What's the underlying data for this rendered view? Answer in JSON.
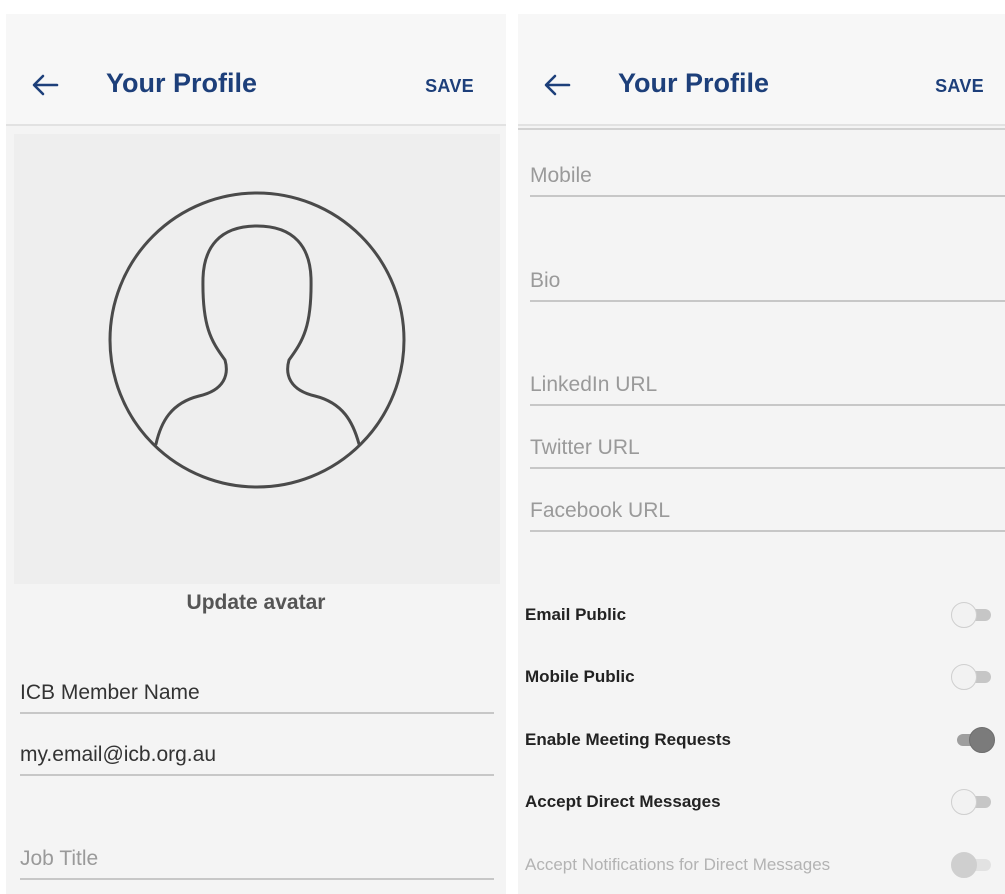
{
  "left_screen": {
    "header": {
      "title": "Your Profile",
      "save_label": "SAVE"
    },
    "avatar": {
      "action_label": "Update avatar"
    },
    "fields": [
      {
        "value": "ICB Member Name",
        "placeholder": ""
      },
      {
        "value": "my.email@icb.org.au",
        "placeholder": ""
      },
      {
        "value": "",
        "placeholder": "Job Title"
      }
    ]
  },
  "right_screen": {
    "header": {
      "title": "Your Profile",
      "save_label": "SAVE"
    },
    "fields": [
      {
        "value": "",
        "placeholder": "Mobile"
      },
      {
        "value": "",
        "placeholder": "Bio"
      },
      {
        "value": "",
        "placeholder": "LinkedIn URL"
      },
      {
        "value": "",
        "placeholder": "Twitter URL"
      },
      {
        "value": "",
        "placeholder": "Facebook URL"
      }
    ],
    "toggles": [
      {
        "label": "Email Public",
        "on": false,
        "enabled": true
      },
      {
        "label": "Mobile Public",
        "on": false,
        "enabled": true
      },
      {
        "label": "Enable Meeting Requests",
        "on": true,
        "enabled": true
      },
      {
        "label": "Accept Direct Messages",
        "on": false,
        "enabled": true
      },
      {
        "label": "Accept Notifications for Direct Messages",
        "on": false,
        "enabled": false
      }
    ]
  },
  "colors": {
    "accent": "#1d3f7a",
    "background": "#f4f4f4",
    "divider": "#c7c7c7"
  },
  "icons": [
    "arrow-left-icon",
    "avatar-placeholder-icon"
  ]
}
